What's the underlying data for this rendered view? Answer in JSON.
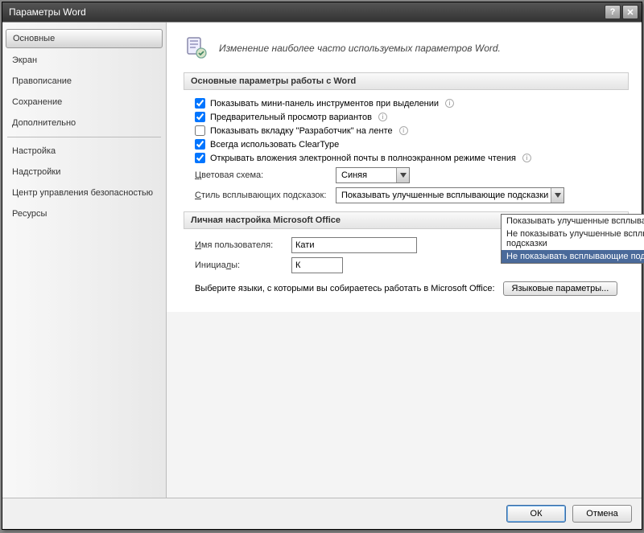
{
  "title": "Параметры Word",
  "sidebar": {
    "items": [
      {
        "label": "Основные",
        "selected": true
      },
      {
        "label": "Экран"
      },
      {
        "label": "Правописание"
      },
      {
        "label": "Сохранение"
      },
      {
        "label": "Дополнительно"
      },
      {
        "label": "Настройка"
      },
      {
        "label": "Надстройки"
      },
      {
        "label": "Центр управления безопасностью"
      },
      {
        "label": "Ресурсы"
      }
    ]
  },
  "header_line": "Изменение наиболее часто используемых параметров Word.",
  "section1": {
    "title": "Основные параметры работы с Word",
    "checks": [
      {
        "label": "Показывать мини-панель инструментов при выделении",
        "checked": true,
        "info": true
      },
      {
        "label": "Предварительный просмотр вариантов",
        "checked": true,
        "info": true
      },
      {
        "label": "Показывать вкладку \"Разработчик\" на ленте",
        "checked": false,
        "info": true
      },
      {
        "label": "Всегда использовать ClearType",
        "checked": true,
        "info": false
      },
      {
        "label": "Открывать вложения электронной почты в полноэкранном режиме чтения",
        "checked": true,
        "info": true
      }
    ],
    "color_label": "Цветовая схема:",
    "color_value": "Синяя",
    "tooltip_label": "Стиль всплывающих подсказок:",
    "tooltip_value": "Показывать улучшенные всплывающие подсказки",
    "tooltip_options": [
      "Показывать улучшенные всплывающие подсказки",
      "Не показывать улучшенные всплывающие подсказки",
      "Не показывать всплывающие подсказки"
    ],
    "tooltip_highlight_index": 2
  },
  "section2": {
    "title": "Личная настройка Microsoft Office",
    "username_label": "Имя пользователя:",
    "username_value": "Кати",
    "initials_label": "Инициалы:",
    "initials_value": "К",
    "lang_text": "Выберите языки, с которыми вы собираетесь работать в Microsoft Office:",
    "lang_button": "Языковые параметры..."
  },
  "footer": {
    "ok": "ОК",
    "cancel": "Отмена"
  }
}
